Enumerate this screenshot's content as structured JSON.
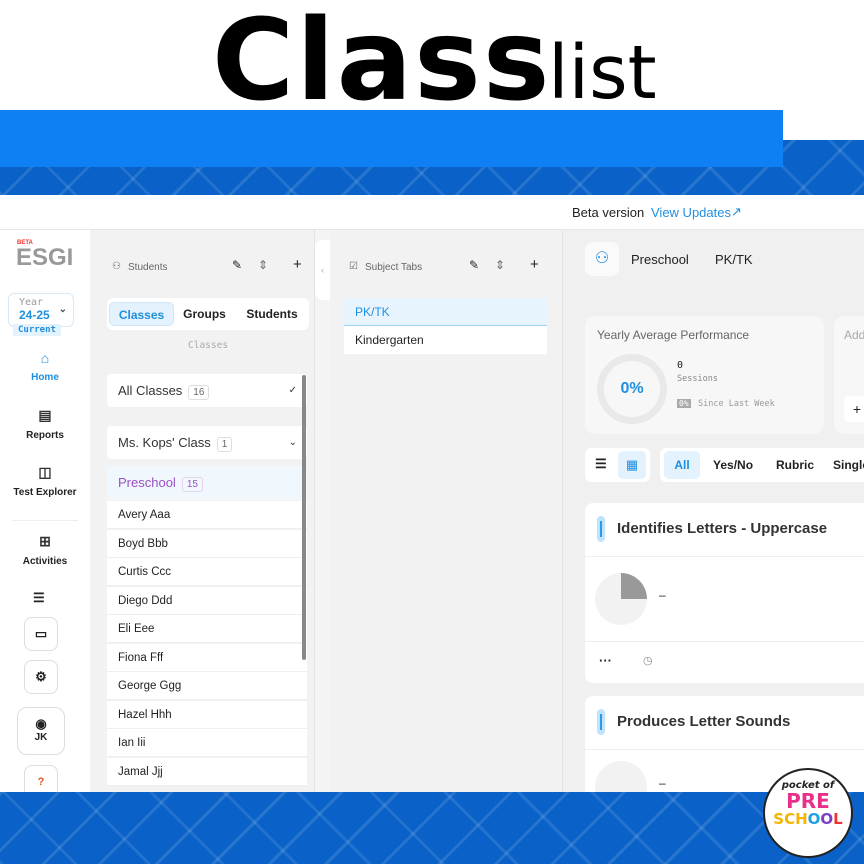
{
  "header": {
    "title_main": "Class",
    "title_script": "list"
  },
  "topbar": {
    "beta_label": "Beta version",
    "view_updates": "View Updates"
  },
  "nav": {
    "logo_beta": "BETA",
    "logo": "ESGI",
    "year_label": "Year",
    "year_value": "24-25",
    "year_status": "Current",
    "items": [
      {
        "label": "Home",
        "icon": "home-icon"
      },
      {
        "label": "Reports",
        "icon": "reports-icon"
      },
      {
        "label": "Test Explorer",
        "icon": "book-icon"
      },
      {
        "label": "Activities",
        "icon": "grid-icon"
      }
    ],
    "user_initials": "JK",
    "help": "?"
  },
  "students_panel": {
    "title": "Students",
    "tabs": [
      "Classes",
      "Groups",
      "Students"
    ],
    "active_tab": "Classes",
    "section_label": "Classes",
    "all_classes": {
      "label": "All Classes",
      "count": "16"
    },
    "teacher_class": {
      "label": "Ms. Kops' Class",
      "count": "1"
    },
    "selected_class": {
      "label": "Preschool",
      "count": "15"
    },
    "students": [
      "Avery Aaa",
      "Boyd Bbb",
      "Curtis Ccc",
      "Diego Ddd",
      "Eli Eee",
      "Fiona Fff",
      "George Ggg",
      "Hazel Hhh",
      "Ian Iii",
      "Jamal Jjj"
    ]
  },
  "subjects_panel": {
    "title": "Subject Tabs",
    "tabs": [
      "PK/TK",
      "Kindergarten"
    ],
    "active": "PK/TK"
  },
  "main": {
    "class_name": "Preschool",
    "subject": "PK/TK",
    "performance": {
      "title": "Yearly Average Performance",
      "percent": "0%",
      "sessions": "0",
      "sessions_label": "Sessions",
      "change": "0%",
      "change_label": "Since Last Week"
    },
    "add_card_title": "Add",
    "add_button": "+",
    "filters": [
      "All",
      "Yes/No",
      "Rubric",
      "Single"
    ],
    "active_filter": "All",
    "tests": [
      {
        "title": "Identifies Letters - Uppercase",
        "value": "–",
        "progress": 0.25
      },
      {
        "title": "Produces Letter Sounds",
        "value": "–",
        "progress": 0
      }
    ]
  },
  "accent": "#1f8fe0",
  "brand_blue": "#0f7ff4",
  "branding": {
    "logo_text": [
      "pocket of",
      "PRE",
      "SCHOOL"
    ]
  }
}
